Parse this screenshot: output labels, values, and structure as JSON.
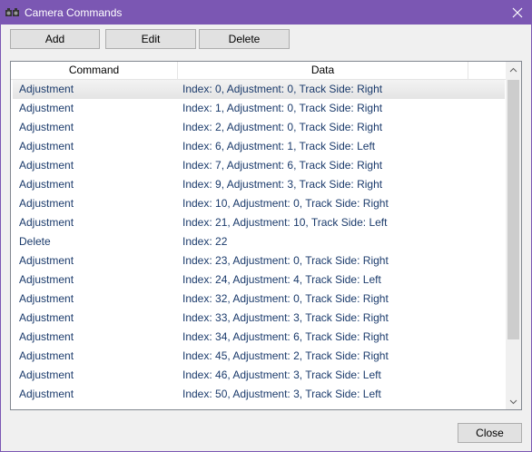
{
  "window": {
    "title": "Camera Commands"
  },
  "toolbar": {
    "add_label": "Add",
    "edit_label": "Edit",
    "delete_label": "Delete"
  },
  "table": {
    "columns": [
      "Command",
      "Data"
    ],
    "rows": [
      {
        "command": "Adjustment",
        "data": "Index: 0, Adjustment: 0, Track Side: Right"
      },
      {
        "command": "Adjustment",
        "data": "Index: 1, Adjustment: 0, Track Side: Right"
      },
      {
        "command": "Adjustment",
        "data": "Index: 2, Adjustment: 0, Track Side: Right"
      },
      {
        "command": "Adjustment",
        "data": "Index: 6, Adjustment: 1, Track Side: Left"
      },
      {
        "command": "Adjustment",
        "data": "Index: 7, Adjustment: 6, Track Side: Right"
      },
      {
        "command": "Adjustment",
        "data": "Index: 9, Adjustment: 3, Track Side: Right"
      },
      {
        "command": "Adjustment",
        "data": "Index: 10, Adjustment: 0, Track Side: Right"
      },
      {
        "command": "Adjustment",
        "data": "Index: 21, Adjustment: 10, Track Side: Left"
      },
      {
        "command": "Delete",
        "data": "Index: 22"
      },
      {
        "command": "Adjustment",
        "data": "Index: 23, Adjustment: 0, Track Side: Right"
      },
      {
        "command": "Adjustment",
        "data": "Index: 24, Adjustment: 4, Track Side: Left"
      },
      {
        "command": "Adjustment",
        "data": "Index: 32, Adjustment: 0, Track Side: Right"
      },
      {
        "command": "Adjustment",
        "data": "Index: 33, Adjustment: 3, Track Side: Right"
      },
      {
        "command": "Adjustment",
        "data": "Index: 34, Adjustment: 6, Track Side: Right"
      },
      {
        "command": "Adjustment",
        "data": "Index: 45, Adjustment: 2, Track Side: Right"
      },
      {
        "command": "Adjustment",
        "data": "Index: 46, Adjustment: 3, Track Side: Left"
      },
      {
        "command": "Adjustment",
        "data": "Index: 50, Adjustment: 3, Track Side: Left"
      }
    ],
    "selected_index": 0
  },
  "footer": {
    "close_label": "Close"
  },
  "icons": {
    "title": "camera-icon",
    "close": "close-icon",
    "scroll_up": "chevron-up-icon",
    "scroll_down": "chevron-down-icon"
  },
  "colors": {
    "titlebar": "#7b57b3",
    "row_text": "#1a3a6b",
    "selection": "#e8e8e8"
  }
}
